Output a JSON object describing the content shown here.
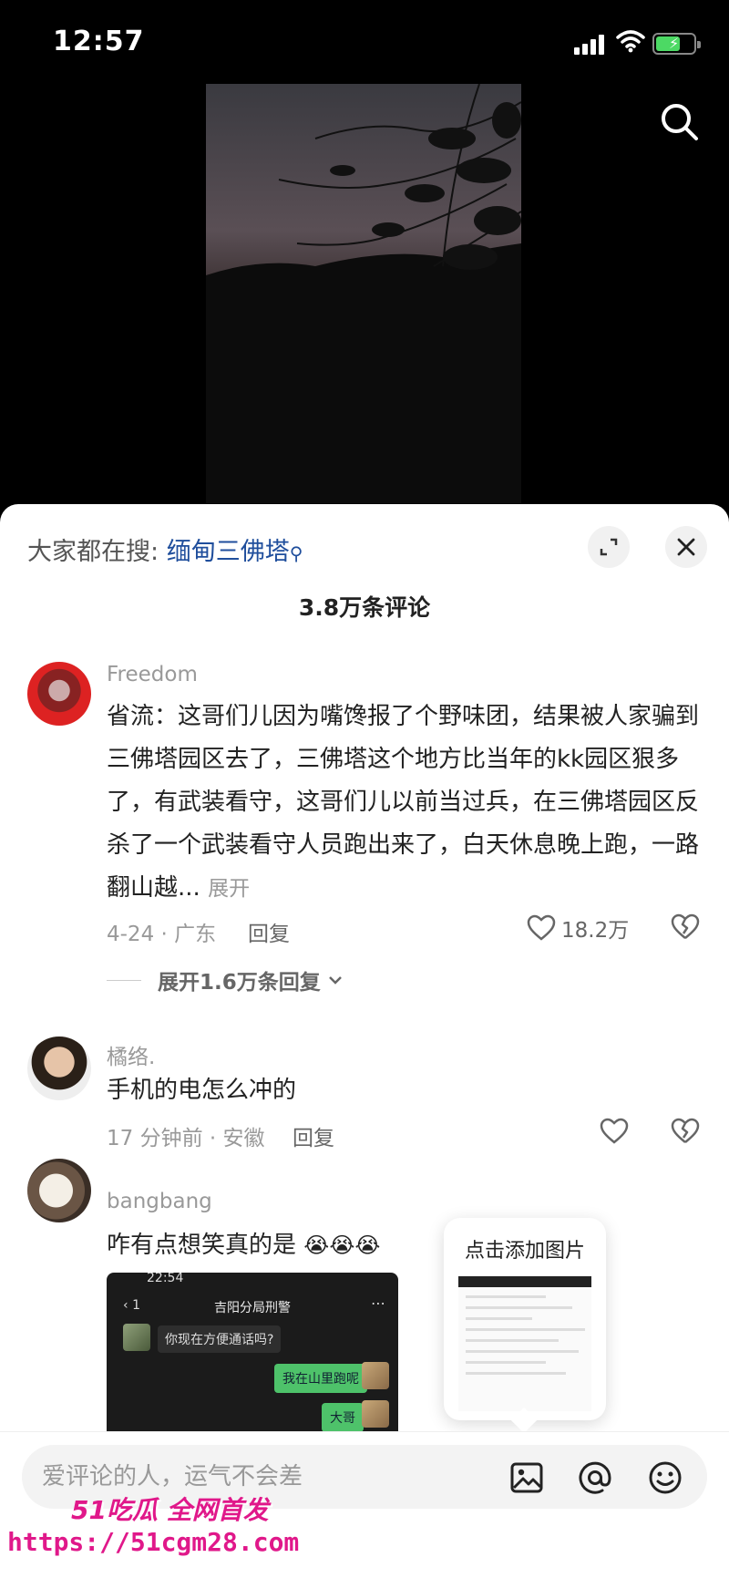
{
  "status_bar": {
    "time": "12:57"
  },
  "sheet": {
    "hot_search_prefix": "大家都在搜:",
    "hot_search_keyword": "缅甸三佛塔",
    "comment_count": "3.8万条评论"
  },
  "comments": [
    {
      "name": "Freedom",
      "text": "省流：这哥们儿因为嘴馋报了个野味团，结果被人家骗到三佛塔园区去了，三佛塔这个地方比当年的kk园区狠多了，有武装看守，这哥们儿以前当过兵，在三佛塔园区反杀了一个武装看守人员跑出来了，白天休息晚上跑，一路翻山越...",
      "more": "展开",
      "meta": "4-24 · 广东",
      "reply": "回复",
      "likes": "18.2万",
      "expand_replies": "展开1.6万条回复"
    },
    {
      "name": "橘络.",
      "text": "手机的电怎么冲的",
      "meta": "17 分钟前 · 安徽",
      "reply": "回复"
    },
    {
      "name": "bangbang",
      "text": "咋有点想笑真的是",
      "emoji": "😭😭😭"
    }
  ],
  "embedded_screenshot": {
    "status_time": "22:54",
    "title": "吉阳分局刑警",
    "back_count": "1",
    "msg_incoming": "你现在方便通话吗?",
    "msg_out_1": "我在山里跑呢",
    "msg_out_2": "大哥"
  },
  "add_image_popup": {
    "title": "点击添加图片"
  },
  "input_bar": {
    "placeholder": "爱评论的人，运气不会差"
  },
  "watermark": {
    "line1": "51吃瓜 全网首发",
    "line2": "https://51cgm28.com"
  },
  "colors": {
    "accent_blue": "#1f4e9c",
    "battery_green": "#4cd964",
    "chat_green": "#4ec26a",
    "watermark_pink": "#e0188a"
  }
}
